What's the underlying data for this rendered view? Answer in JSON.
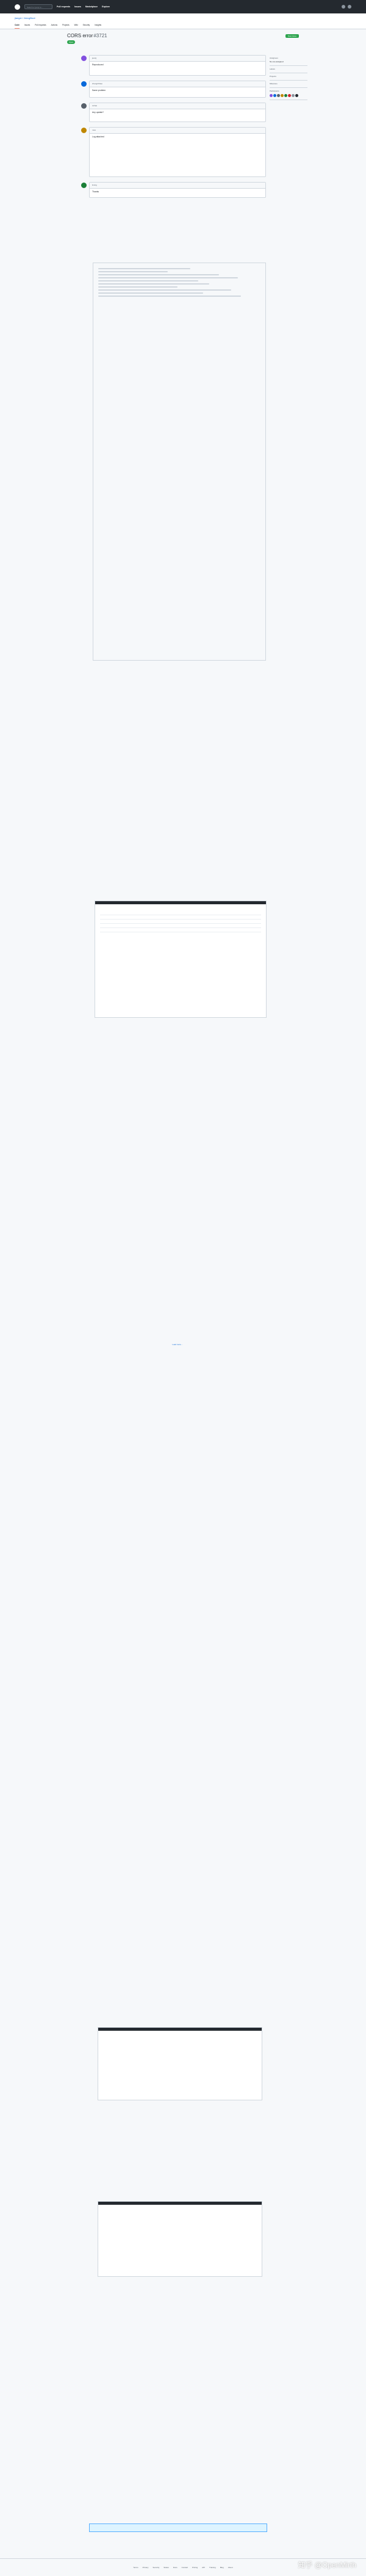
{
  "nav": {
    "search": "Search or jump to…",
    "items": [
      "Pull requests",
      "Issues",
      "Marketplace",
      "Explore"
    ]
  },
  "repo": {
    "path": "jiangxi / JeecgBoot"
  },
  "tabs": [
    "Code",
    "Issues",
    "Pull requests",
    "Actions",
    "Projects",
    "Wiki",
    "Security",
    "Insights"
  ],
  "issue": {
    "title": "CORS error",
    "number": "#3721",
    "state": "Open",
    "new_issue": "New issue"
  },
  "comments": [
    {
      "author": "jeecg",
      "time": "commented",
      "text": "Reproduced"
    },
    {
      "author": "zhangzhihao",
      "time": "commented",
      "text": "Same problem"
    },
    {
      "author": "xuhao",
      "time": "commented",
      "text": "Any update?"
    },
    {
      "author": "mwx",
      "time": "commented",
      "text": "Log attached"
    },
    {
      "author": "liming",
      "time": "commented",
      "text": "Thanks"
    }
  ],
  "sidebar": {
    "assignees": "Assignees",
    "labels": "Labels",
    "projects": "Projects",
    "milestone": "Milestone",
    "participants": "Participants",
    "none": "No one assigned"
  },
  "load_more": "Load more…",
  "footer": [
    "Terms",
    "Privacy",
    "Security",
    "Status",
    "Docs",
    "Contact",
    "Pricing",
    "API",
    "Training",
    "Blog",
    "About"
  ],
  "watermark": "知乎 @OpenMirth",
  "chart_colors": {
    "green": "#2da44e",
    "purple": "#8250df",
    "blue": "#0969da"
  }
}
